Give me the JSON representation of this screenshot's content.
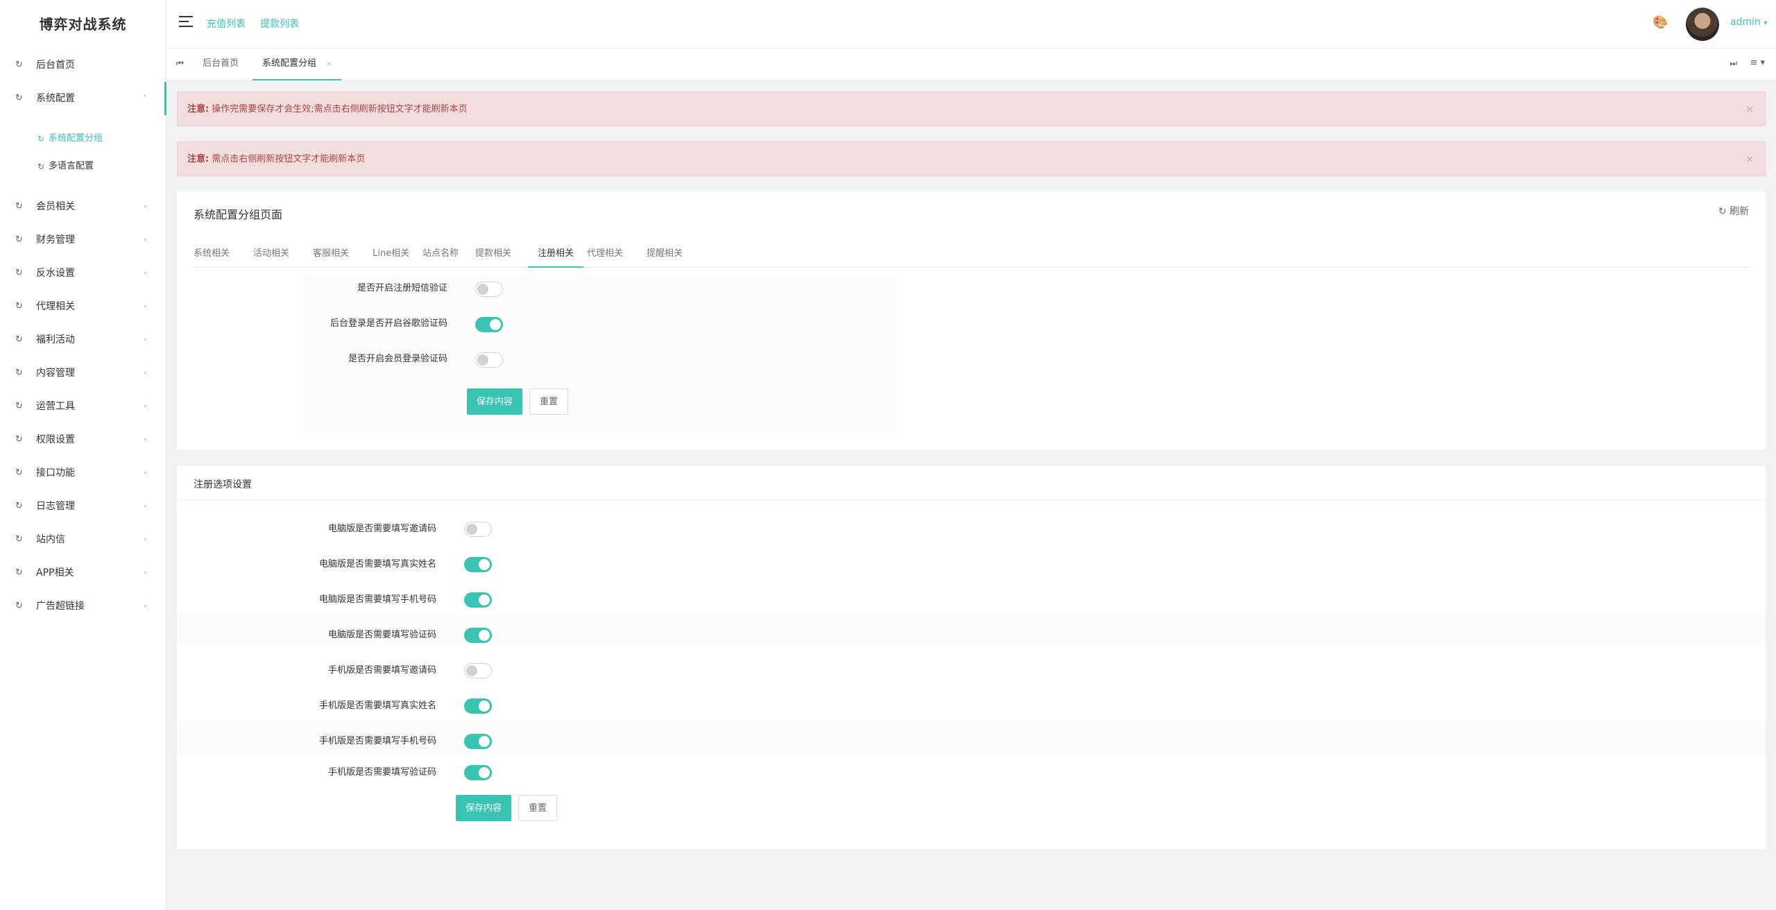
{
  "app": {
    "title": "博弈对战系统"
  },
  "sidebar": {
    "items": [
      {
        "label": "后台首页",
        "icon": "refresh-icon"
      },
      {
        "label": "系统配置",
        "icon": "refresh-icon",
        "expanded": true,
        "children": [
          {
            "label": "系统配置分组",
            "active": true
          },
          {
            "label": "多语言配置"
          }
        ]
      },
      {
        "label": "会员相关"
      },
      {
        "label": "财务管理"
      },
      {
        "label": "反水设置"
      },
      {
        "label": "代理相关"
      },
      {
        "label": "福利活动"
      },
      {
        "label": "内容管理"
      },
      {
        "label": "运营工具"
      },
      {
        "label": "权限设置"
      },
      {
        "label": "接口功能"
      },
      {
        "label": "日志管理"
      },
      {
        "label": "站内信"
      },
      {
        "label": "APP相关"
      },
      {
        "label": "广告超链接"
      }
    ]
  },
  "header": {
    "links": [
      "充值列表",
      "提款列表"
    ],
    "user": "admin",
    "user_caret": "▾",
    "theme_icon": "palette-icon"
  },
  "tabs": {
    "items": [
      {
        "label": "后台首页"
      },
      {
        "label": "系统配置分组",
        "active": true,
        "close": "×"
      }
    ]
  },
  "alerts": [
    {
      "prefix": "注意:",
      "text": "操作完需要保存才会生效;需点击右侧刷新按钮文字才能刷新本页",
      "close": "×"
    },
    {
      "prefix": "注意:",
      "text": "需点击右侧刷新按钮文字才能刷新本页",
      "close": "×"
    }
  ],
  "config_card": {
    "title": "系统配置分组页面",
    "refresh_icon": "↻",
    "refresh_label": "刷新",
    "tabs": [
      "系统相关",
      "活动相关",
      "客服相关",
      "Line相关",
      "站点名称",
      "提款相关",
      "注册相关",
      "代理相关",
      "提醒相关"
    ],
    "active_tab": "注册相关",
    "fields": [
      {
        "label": "是否开启注册短信验证",
        "on": false
      },
      {
        "label": "后台登录是否开启谷歌验证码",
        "on": true
      },
      {
        "label": "是否开启会员登录验证码",
        "on": false
      }
    ],
    "save_label": "保存内容",
    "reset_label": "重置"
  },
  "register_card": {
    "title": "注册选项设置",
    "fields": [
      {
        "label": "电脑版是否需要填写邀请码",
        "on": false
      },
      {
        "label": "电脑版是否需要填写真实姓名",
        "on": true
      },
      {
        "label": "电脑版是否需要填写手机号码",
        "on": true
      },
      {
        "label": "电脑版是否需要填写验证码",
        "on": true
      },
      {
        "label": "手机版是否需要填写邀请码",
        "on": false
      },
      {
        "label": "手机版是否需要填写真实姓名",
        "on": true
      },
      {
        "label": "手机版是否需要填写手机号码",
        "on": true
      },
      {
        "label": "手机版是否需要填写验证码",
        "on": true
      }
    ],
    "save_label": "保存内容",
    "reset_label": "重置"
  },
  "colors": {
    "accent": "#38c3b3",
    "alert_bg": "#f2dede",
    "alert_text": "#a94442"
  }
}
